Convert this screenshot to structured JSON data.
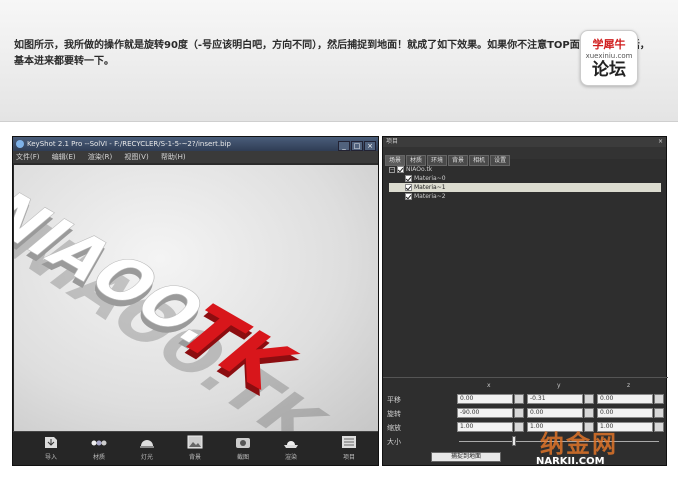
{
  "banner": {
    "text": "如图所示，我所做的操作就是旋转90度（-号应该明白吧，方向不同），然后捕捉到地面！就成了如下效果。如果你不注意TOP面而随意建的话，基本进来都要转一下。"
  },
  "forum_logo": {
    "line1": "学犀牛",
    "line2": "xuexiniu.com",
    "line3": "论坛"
  },
  "keyshot": {
    "title": "KeyShot 2.1 Pro --SolVI - F:/RECYCLER/S-1-5-~2?/insert.bip",
    "window_buttons": [
      "_",
      "□",
      "×"
    ],
    "menu": [
      "文件(F)",
      "编辑(E)",
      "渲染(R)",
      "视图(V)",
      "帮助(H)"
    ],
    "scene_text_white": "NIAOO.",
    "scene_text_red": "TK",
    "toolbar": [
      {
        "label": "导入",
        "icon": "import-icon"
      },
      {
        "label": "材质",
        "icon": "materials-icon"
      },
      {
        "label": "灯光",
        "icon": "lighting-icon"
      },
      {
        "label": "背景",
        "icon": "background-icon"
      },
      {
        "label": "截图",
        "icon": "screenshot-icon"
      },
      {
        "label": "渲染",
        "icon": "render-icon"
      },
      {
        "label": "项目",
        "icon": "project-icon"
      }
    ]
  },
  "panel": {
    "title": "项目",
    "tabs": [
      "场景",
      "材质",
      "环境",
      "背景",
      "相机",
      "设置"
    ],
    "tree": [
      {
        "label": "NIAOo.tk",
        "expanded": true,
        "checked": true
      },
      {
        "label": "Materia~0",
        "checked": true,
        "selected": false
      },
      {
        "label": "Materia~1",
        "checked": true,
        "selected": true
      },
      {
        "label": "Materia~2",
        "checked": true,
        "selected": false
      }
    ],
    "transform": {
      "columns": [
        "x",
        "y",
        "z"
      ],
      "rows": [
        {
          "label": "平移",
          "values": [
            "0.00",
            "-0.31",
            "0.00"
          ]
        },
        {
          "label": "旋转",
          "values": [
            "-90.00",
            "0.00",
            "0.00"
          ]
        },
        {
          "label": "缩放",
          "values": [
            "1.00",
            "1.00",
            "1.00"
          ]
        }
      ],
      "size_label": "大小",
      "snap_button": "捕捉到地面"
    }
  },
  "watermark": {
    "cn": "纳金网",
    "en": "NARKII.COM"
  },
  "colors": {
    "red_text": "#d8161b",
    "white_text": "#ffffff",
    "panel_bg": "#2e2e2e"
  }
}
